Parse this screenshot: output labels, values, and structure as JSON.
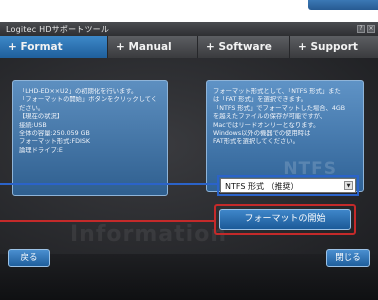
{
  "window": {
    "title": "Logitec HDサポートツール"
  },
  "titlebar_buttons": [
    "?",
    "×"
  ],
  "tabs": [
    {
      "label": "+ Format",
      "active": true
    },
    {
      "label": "+ Manual",
      "active": false
    },
    {
      "label": "+ Software",
      "active": false
    },
    {
      "label": "+ Support",
      "active": false
    }
  ],
  "info_panel": {
    "lines": [
      "「LHD-ED××U2」の初期化を行います。",
      "「フォーマットの開始」ボタンをクリックしてく",
      "ださい。",
      "【現在の状況】",
      "接続:USB",
      "全体の容量:250.059 GB",
      "フォーマット形式:FDISK",
      "論理ドライブ:E"
    ],
    "watermark": "Information"
  },
  "format_panel": {
    "lines": [
      "フォーマット形式として、「NTFS 形式」また",
      "は「FAT 形式」を選択できます。",
      "「NTFS 形式」でフォーマットした場合、4GB",
      "を越えたファイルの保存が可能ですが、",
      "Macではリードオンリーとなります。",
      "Windows以外の機器での使用時は",
      "FAT形式を選択してください。"
    ],
    "watermark": "NTFS"
  },
  "format_select": {
    "value": "NTFS 形式 （推奨）"
  },
  "start_button": {
    "label": "フォーマットの開始"
  },
  "footer": {
    "back_label": "戻る",
    "close_label": "閉じる"
  },
  "colors": {
    "accent_blue": "#2b63c9",
    "accent_red": "#c42a2a",
    "tab_active": "#2f72b4"
  }
}
